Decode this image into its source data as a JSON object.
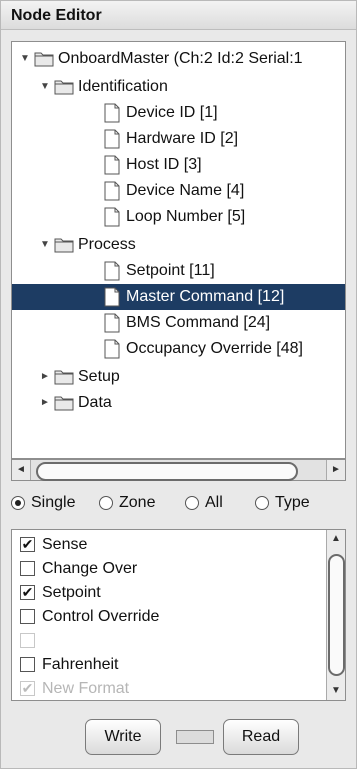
{
  "window": {
    "title": "Node Editor"
  },
  "tree": {
    "root": "OnboardMaster (Ch:2 Id:2 Serial:1",
    "groups": [
      {
        "label": "Identification",
        "items": [
          "Device ID [1]",
          "Hardware ID [2]",
          "Host ID [3]",
          "Device Name [4]",
          "Loop Number [5]"
        ]
      },
      {
        "label": "Process",
        "items": [
          "Setpoint [11]",
          "Master Command [12]",
          "BMS Command [24]",
          "Occupancy Override [48]"
        ]
      },
      {
        "label": "Setup"
      },
      {
        "label": "Data"
      }
    ],
    "selected": "Master Command [12]"
  },
  "radios": {
    "options": [
      "Single",
      "Zone",
      "All",
      "Type"
    ],
    "selected": "Single"
  },
  "checklist": {
    "items": [
      {
        "label": "Sense",
        "checked": true
      },
      {
        "label": "Change Over",
        "checked": false
      },
      {
        "label": "Setpoint",
        "checked": true
      },
      {
        "label": "Control Override",
        "checked": false
      },
      {
        "label": "",
        "checked": false,
        "disabled": true
      },
      {
        "label": "Fahrenheit",
        "checked": false
      },
      {
        "label": "New Format",
        "checked": true,
        "disabled": true
      }
    ]
  },
  "buttons": {
    "write": "Write",
    "read": "Read"
  },
  "colors": {
    "selection": "#1d3c63"
  },
  "icons": {
    "folder": "folder-icon",
    "page": "document-icon",
    "expanded": "triangle-down-icon",
    "collapsed": "triangle-right-icon"
  }
}
